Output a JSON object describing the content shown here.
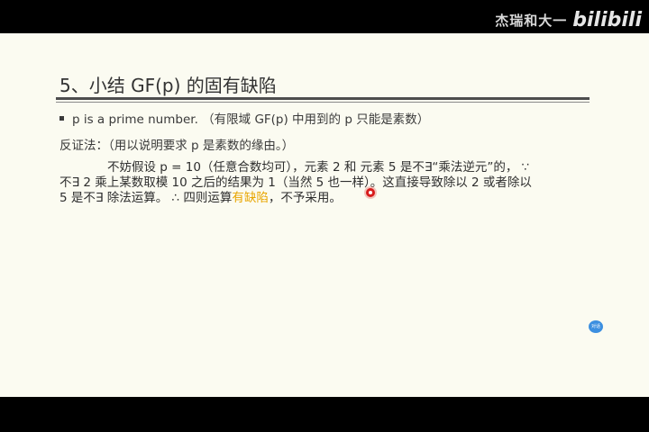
{
  "watermark": {
    "uploader": "杰瑞和大一",
    "brand": "bilibili"
  },
  "slide": {
    "title": "5、小结 GF(p) 的固有缺陷",
    "bullet": "p is a prime number. （有限域 GF(p) 中用到的 p 只能是素数）",
    "proof_heading": "反证法：（用以说明要求 p 是素数的缘由。）",
    "paragraph": {
      "line1": "不妨假设 p = 10（任意合数均可），元素 2 和 元素 5 是不∃“乘法逆元”的， ∵",
      "line2": "不∃ 2 乘上某数取模 10 之后的结果为 1（当然 5 也一样）。这直接导致除以 2 或者除以",
      "line3_before": "5 是不∃ 除法运算。 ∴ 四则运算",
      "line3_highlight": "有缺陷",
      "line3_after": "，不予采用。"
    },
    "chat_bubble_label": "对话"
  },
  "colors": {
    "slide_background": "#fbfbf1",
    "highlight": "#e8a500",
    "cursor": "#d81b1b"
  }
}
